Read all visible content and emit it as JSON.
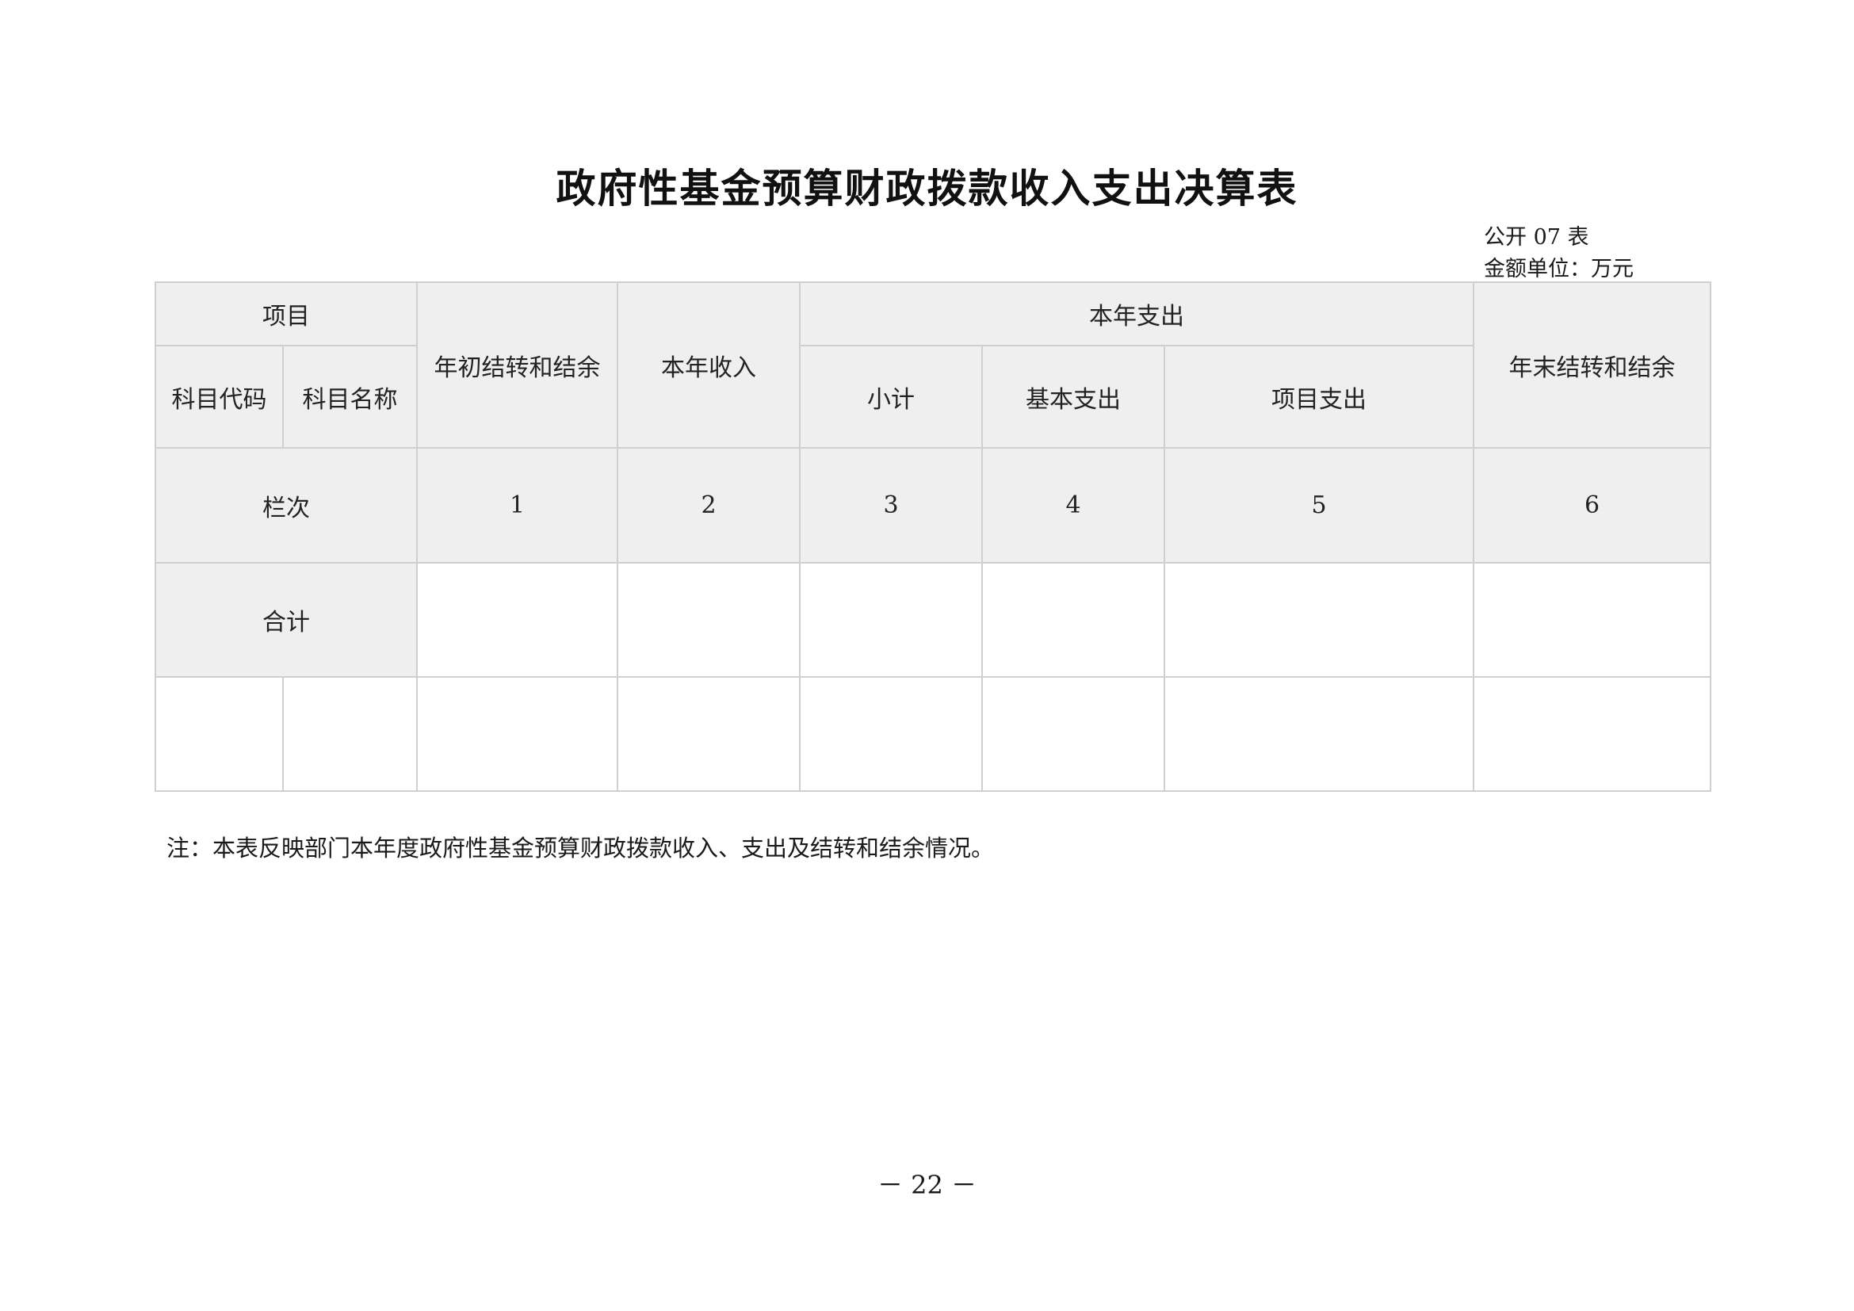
{
  "document": {
    "title": "政府性基金预算财政拨款收入支出决算表",
    "form_number": "公开 07 表",
    "unit": "金额单位：万元",
    "note": "注：本表反映部门本年度政府性基金预算财政拨款收入、支出及结转和结余情况。",
    "page_number": "－ 22 －"
  },
  "table": {
    "headers": {
      "item": "项目",
      "subject_code": "科目代码",
      "subject_name": "科目名称",
      "opening_balance": "年初结转和结余",
      "current_income": "本年收入",
      "current_expense": "本年支出",
      "subtotal": "小计",
      "basic_expense": "基本支出",
      "project_expense": "项目支出",
      "closing_balance": "年末结转和结余"
    },
    "column_numbers": {
      "label": "栏次",
      "values": [
        "1",
        "2",
        "3",
        "4",
        "5",
        "6"
      ]
    },
    "total_row": {
      "label": "合计",
      "values": [
        "",
        "",
        "",
        "",
        "",
        ""
      ]
    },
    "data_rows": [
      {
        "code": "",
        "name": "",
        "values": [
          "",
          "",
          "",
          "",
          "",
          ""
        ]
      }
    ]
  }
}
